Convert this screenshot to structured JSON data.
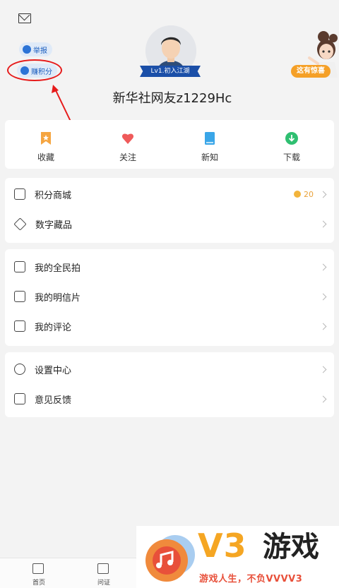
{
  "header": {
    "report_label": "举报",
    "earn_points_label": "赚积分",
    "level_badge": "Lv1.初入江湖",
    "username": "新华社网友z1229Hc",
    "promo_badge": "这有惊喜"
  },
  "quick_actions": [
    {
      "label": "收藏",
      "icon": "bookmark-icon",
      "color": "#f5a540"
    },
    {
      "label": "关注",
      "icon": "heart-icon",
      "color": "#ef5a5a"
    },
    {
      "label": "新知",
      "icon": "book-icon",
      "color": "#3aa6e8"
    },
    {
      "label": "下载",
      "icon": "download-icon",
      "color": "#2fbf71"
    }
  ],
  "section1": [
    {
      "label": "积分商城",
      "icon": "points-store-icon",
      "points": "20"
    },
    {
      "label": "数字藏品",
      "icon": "digital-collectible-icon"
    }
  ],
  "section2": [
    {
      "label": "我的全民拍",
      "icon": "camera-icon"
    },
    {
      "label": "我的明信片",
      "icon": "postcard-icon"
    },
    {
      "label": "我的评论",
      "icon": "comment-icon"
    }
  ],
  "section3": [
    {
      "label": "设置中心",
      "icon": "settings-icon"
    },
    {
      "label": "意见反馈",
      "icon": "feedback-icon"
    }
  ],
  "tabbar": [
    {
      "label": "首页",
      "icon": "home-icon"
    },
    {
      "label": "问证",
      "icon": "verify-icon"
    }
  ],
  "watermark": {
    "brand": "V3",
    "brand_cn": "游戏",
    "tagline": "游戏人生，不负VVVV3"
  }
}
